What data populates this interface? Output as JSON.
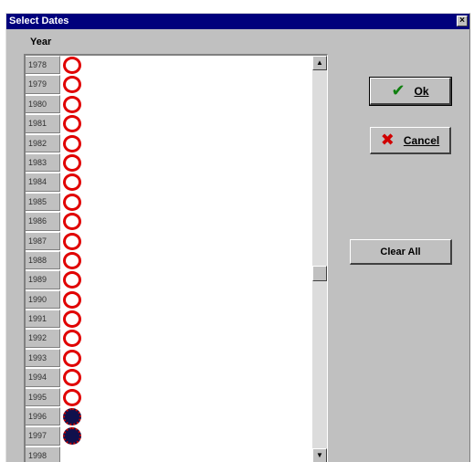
{
  "window": {
    "title": "Select Dates",
    "close_glyph": "×"
  },
  "list": {
    "header": "Year",
    "rows": [
      {
        "year": "1978",
        "state": "open"
      },
      {
        "year": "1979",
        "state": "open"
      },
      {
        "year": "1980",
        "state": "open"
      },
      {
        "year": "1981",
        "state": "open"
      },
      {
        "year": "1982",
        "state": "open"
      },
      {
        "year": "1983",
        "state": "open"
      },
      {
        "year": "1984",
        "state": "open"
      },
      {
        "year": "1985",
        "state": "open"
      },
      {
        "year": "1986",
        "state": "open"
      },
      {
        "year": "1987",
        "state": "open"
      },
      {
        "year": "1988",
        "state": "open"
      },
      {
        "year": "1989",
        "state": "open"
      },
      {
        "year": "1990",
        "state": "open"
      },
      {
        "year": "1991",
        "state": "open"
      },
      {
        "year": "1992",
        "state": "open"
      },
      {
        "year": "1993",
        "state": "open"
      },
      {
        "year": "1994",
        "state": "open"
      },
      {
        "year": "1995",
        "state": "open"
      },
      {
        "year": "1996",
        "state": "selected"
      },
      {
        "year": "1997",
        "state": "selected"
      },
      {
        "year": "1998",
        "state": "empty"
      }
    ],
    "scroll_position": 0.54
  },
  "buttons": {
    "ok_label": "Ok",
    "cancel_label": "Cancel",
    "clear_label": "Clear All",
    "ok_icon": "✔",
    "cancel_icon": "✖"
  },
  "colors": {
    "titlebar": "#00007c",
    "mark_open": "#e00000",
    "mark_selected": "#10104c",
    "dialog_bg": "#c0c0c0"
  },
  "icons": {
    "close": "close-icon",
    "ok": "check-icon",
    "cancel": "x-icon",
    "year_mark": "circle-icon",
    "scroll_up": "scroll-up-arrow-icon",
    "scroll_down": "scroll-down-arrow-icon"
  }
}
